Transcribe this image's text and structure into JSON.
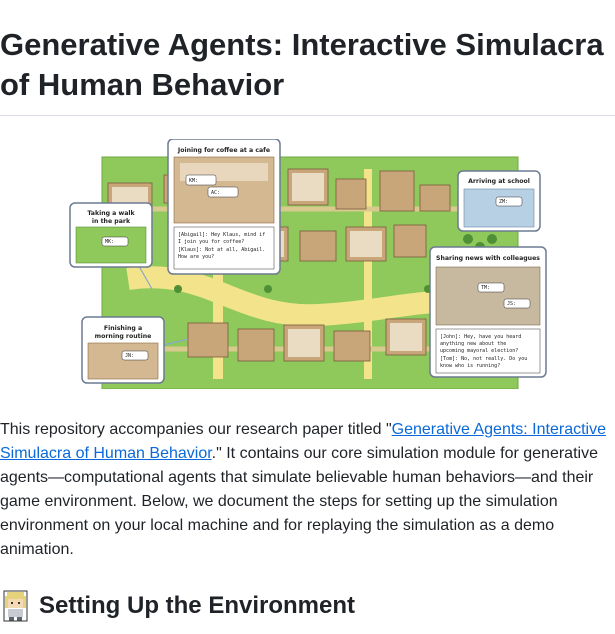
{
  "article": {
    "title": "Generative Agents: Interactive Simulacra of Human Behavior",
    "intro": {
      "before": "This repository accompanies our research paper titled \"",
      "link_text": "Generative Agents: Interactive Simulacra of Human Behavior",
      "after": ".\" It contains our core simulation module for generative agents—computational agents that simulate believable human behaviors—and their game environment. Below, we document the steps for setting up the simulation environment on your local machine and for replaying the simulation as a demo animation."
    },
    "section_heading": "Setting Up the Environment"
  },
  "hero": {
    "callouts": {
      "coffee": "Joining for coffee at a cafe",
      "walk_line1": "Taking a walk",
      "walk_line2": "in the park",
      "school": "Arriving at school",
      "morning_line1": "Finishing a",
      "morning_line2": "morning routine",
      "news": "Sharing news with colleagues"
    },
    "dialogue": {
      "abigail_1": "[Abigail]: Hey Klaus, mind if",
      "abigail_2": "I join you for coffee?",
      "klaus_1": "[Klaus]: Not at all, Abigail.",
      "klaus_2": "How are you?",
      "john_1": "[John]: Hey, have you heard",
      "john_2": "anything new about the",
      "john_3": "upcoming mayoral election?",
      "tom_1": "[Tom]: No, not really. Do you",
      "tom_2": "know who is running?"
    },
    "agent_tags": {
      "coffee_a": "KM:",
      "coffee_b": "AC:",
      "walk": "MK:",
      "school": "ZM:",
      "morning": "JN:",
      "news_a": "TM:",
      "news_b": "JS:"
    }
  },
  "colors": {
    "link": "#0969da",
    "grass": "#9bd35a",
    "path": "#f2e48a"
  }
}
